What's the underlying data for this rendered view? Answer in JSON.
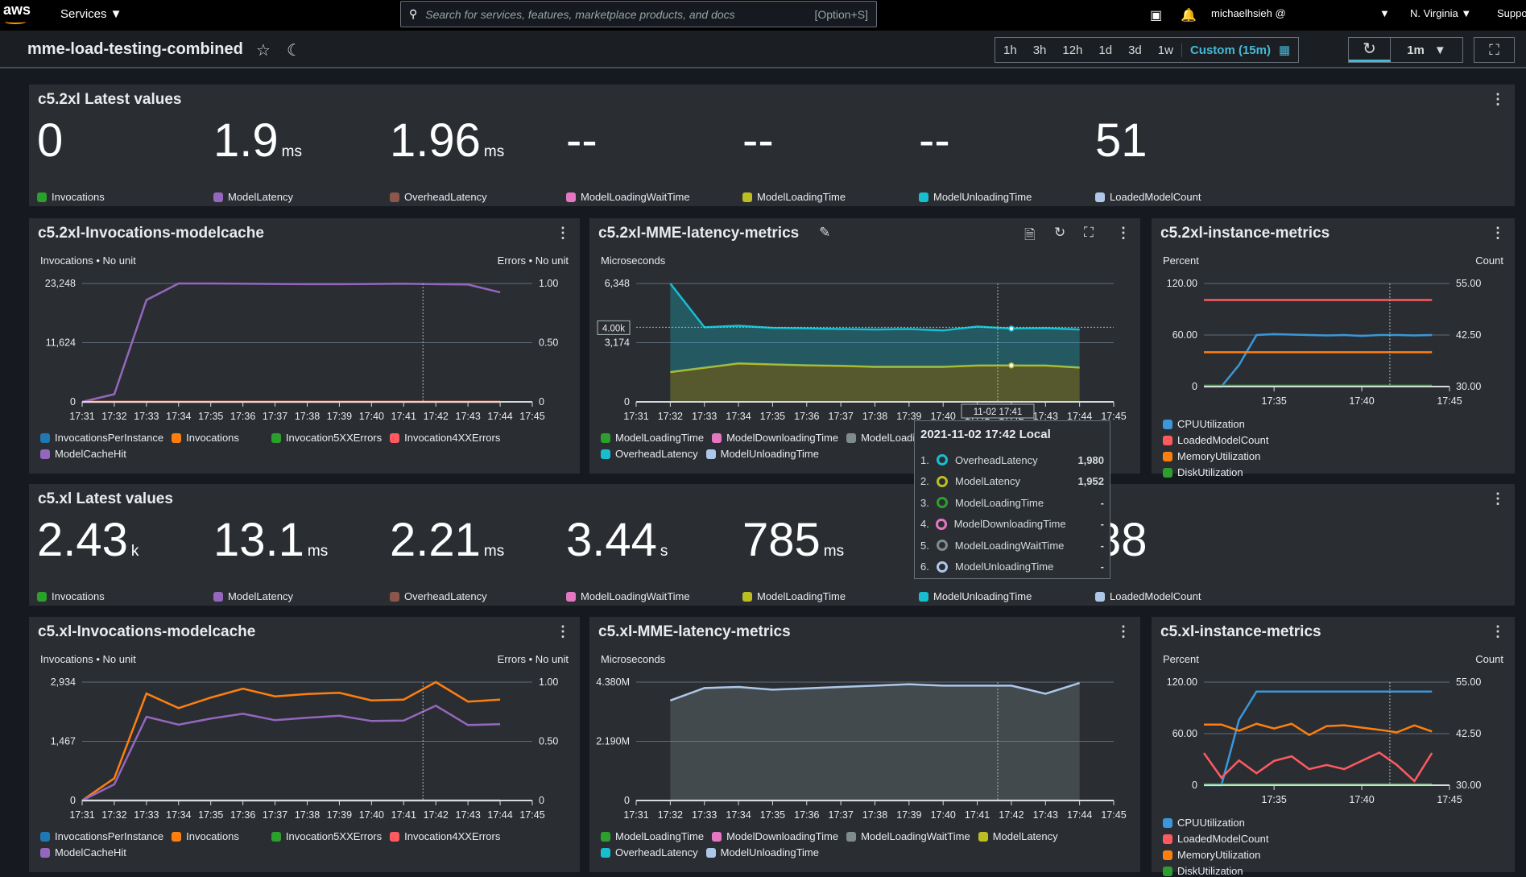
{
  "topbar": {
    "logo": "aws",
    "services_label": "Services ▼",
    "search_placeholder": "Search for services, features, marketplace products, and docs",
    "search_shortcut": "[Option+S]",
    "user": "michaelhsieh @",
    "region": "N. Virginia ▼",
    "support": "Suppo"
  },
  "header": {
    "title": "mme-load-testing-combined",
    "time_ranges": [
      "1h",
      "3h",
      "12h",
      "1d",
      "3d",
      "1w"
    ],
    "custom_range": "Custom (15m)",
    "refresh_interval": "1m"
  },
  "colors": {
    "Invocations": "#2ca02c",
    "ModelLatency": "#9467bd",
    "OverheadLatency": "#8c564b",
    "ModelLoadingWaitTime": "#e377c2",
    "ModelLoadingTime": "#bcbd22",
    "ModelUnloadingTime": "#17becf",
    "LoadedModelCount": "#aec7e8"
  },
  "single_value_widgets": [
    {
      "title": "c5.2xl Latest values",
      "items": [
        {
          "value": "0",
          "unit": "",
          "label": "Invocations",
          "color": "#2ca02c"
        },
        {
          "value": "1.9",
          "unit": "ms",
          "label": "ModelLatency",
          "color": "#9467bd"
        },
        {
          "value": "1.96",
          "unit": "ms",
          "label": "OverheadLatency",
          "color": "#8c564b"
        },
        {
          "value": "--",
          "unit": "",
          "label": "ModelLoadingWaitTime",
          "color": "#e377c2"
        },
        {
          "value": "--",
          "unit": "",
          "label": "ModelLoadingTime",
          "color": "#bcbd22"
        },
        {
          "value": "--",
          "unit": "",
          "label": "ModelUnloadingTime",
          "color": "#17becf"
        },
        {
          "value": "51",
          "unit": "",
          "label": "LoadedModelCount",
          "color": "#aec7e8"
        }
      ]
    },
    {
      "title": "c5.xl Latest values",
      "items": [
        {
          "value": "2.43",
          "unit": "k",
          "label": "Invocations",
          "color": "#2ca02c"
        },
        {
          "value": "13.1",
          "unit": "ms",
          "label": "ModelLatency",
          "color": "#9467bd"
        },
        {
          "value": "2.21",
          "unit": "ms",
          "label": "OverheadLatency",
          "color": "#8c564b"
        },
        {
          "value": "3.44",
          "unit": "s",
          "label": "ModelLoadingWaitTime",
          "color": "#e377c2"
        },
        {
          "value": "785",
          "unit": "ms",
          "label": "ModelLoadingTime",
          "color": "#bcbd22"
        },
        {
          "value": "",
          "unit": "",
          "label": "ModelUnloadingTime",
          "color": "#17becf"
        },
        {
          "value": "38",
          "unit": "",
          "label": "LoadedModelCount",
          "color": "#aec7e8"
        }
      ]
    }
  ],
  "chart_data": [
    {
      "type": "line",
      "kind": "ops",
      "title": "c5.2xl-Invocations-modelcache",
      "left_label": "Invocations • No unit",
      "right_label": "Errors • No unit",
      "x": [
        "17:31",
        "17:32",
        "17:33",
        "17:34",
        "17:35",
        "17:36",
        "17:37",
        "17:38",
        "17:39",
        "17:40",
        "17:41",
        "17:42",
        "17:43",
        "17:44"
      ],
      "xlim": [
        "17:31",
        "17:45"
      ],
      "xticks": [
        "17:31",
        "17:32",
        "17:33",
        "17:34",
        "17:35",
        "17:36",
        "17:37",
        "17:38",
        "17:39",
        "17:40",
        "17:41",
        "17:42",
        "17:43",
        "17:44",
        "17:45"
      ],
      "ylim_left": [
        0,
        23248
      ],
      "yticks_left": [
        "0",
        "11,624",
        "23,248"
      ],
      "ylim_right": [
        0,
        1
      ],
      "yticks_right": [
        "0",
        "0.50",
        "1.00"
      ],
      "series": [
        {
          "name": "InvocationsPerInstance",
          "color": "#1f77b4",
          "axis": "left",
          "values": []
        },
        {
          "name": "Invocations",
          "color": "#ff7f0e",
          "axis": "left",
          "values": [
            0,
            0,
            0,
            0,
            0,
            0,
            0,
            0,
            0,
            0,
            0,
            0,
            0,
            0
          ]
        },
        {
          "name": "Invocation5XXErrors",
          "color": "#2ca02c",
          "axis": "right",
          "values": []
        },
        {
          "name": "Invocation4XXErrors",
          "color": "#ff5a5f",
          "axis": "right",
          "values": [
            0,
            0,
            0,
            0,
            0,
            0,
            0,
            0,
            0,
            0,
            0,
            0,
            0,
            0
          ]
        },
        {
          "name": "ModelCacheHit",
          "color": "#9467bd",
          "axis": "left",
          "values": [
            0,
            1500,
            20000,
            23248,
            23248,
            23200,
            23150,
            23100,
            23100,
            23150,
            23200,
            23100,
            23050,
            21500
          ]
        }
      ]
    },
    {
      "type": "area",
      "kind": "latency",
      "title": "c5.2xl-MME-latency-metrics",
      "left_label": "Microseconds",
      "stacked": true,
      "x": [
        "17:31",
        "17:32",
        "17:33",
        "17:34",
        "17:35",
        "17:36",
        "17:37",
        "17:38",
        "17:39",
        "17:40",
        "17:41",
        "17:42",
        "17:43",
        "17:44"
      ],
      "xlim": [
        "17:31",
        "17:45"
      ],
      "xticks": [
        "17:31",
        "17:32",
        "17:33",
        "17:34",
        "17:35",
        "17:36",
        "17:37",
        "17:38",
        "17:39",
        "17:40",
        "17:41",
        "17:42",
        "17:43",
        "17:44",
        "17:45"
      ],
      "ylim_left": [
        0,
        6348
      ],
      "yticks_left": [
        "0",
        "3,174",
        "6,348"
      ],
      "hover": {
        "y_label": "4.00k",
        "y_value": 4000,
        "x_label": "11-02 17:41"
      },
      "series": [
        {
          "name": "ModelLoadingTime",
          "color": "#2ca02c",
          "axis": "left",
          "values": []
        },
        {
          "name": "ModelDownloadingTime",
          "color": "#e377c2",
          "axis": "left",
          "values": []
        },
        {
          "name": "ModelLoadingWaitTime",
          "color": "#7f8c8d",
          "axis": "left",
          "values": []
        },
        {
          "name": "ModelLatency",
          "color": "#bcbd22",
          "axis": "left",
          "values": [
            null,
            1600,
            1830,
            2060,
            2010,
            1960,
            1930,
            1880,
            1880,
            1880,
            1950,
            1952,
            1950,
            1840
          ]
        },
        {
          "name": "OverheadLatency",
          "color": "#17becf",
          "axis": "left",
          "values": [
            null,
            4748,
            2170,
            2020,
            1960,
            1980,
            1980,
            2000,
            2030,
            1950,
            2090,
            1980,
            2000,
            2040
          ]
        },
        {
          "name": "ModelUnloadingTime",
          "color": "#aec7e8",
          "axis": "left",
          "values": []
        }
      ]
    },
    {
      "type": "line",
      "kind": "instance",
      "title": "c5.2xl-instance-metrics",
      "left_label": "Percent",
      "right_label": "Count",
      "x": [
        "17:31",
        "17:32",
        "17:33",
        "17:34",
        "17:35",
        "17:36",
        "17:37",
        "17:38",
        "17:39",
        "17:40",
        "17:41",
        "17:42",
        "17:43",
        "17:44"
      ],
      "xlim": [
        "17:31",
        "17:45"
      ],
      "xticks": [
        "17:35",
        "17:40",
        "17:45"
      ],
      "ylim_left": [
        0,
        120
      ],
      "yticks_left": [
        "0",
        "60.00",
        "120.00"
      ],
      "ylim_right": [
        30,
        55
      ],
      "yticks_right": [
        "30.00",
        "42.50",
        "55.00"
      ],
      "series": [
        {
          "name": "CPUUtilization",
          "color": "#3b97d9",
          "axis": "left",
          "values": [
            0,
            0,
            25,
            60,
            61,
            60.5,
            60,
            59.5,
            60,
            59,
            60,
            60,
            59.5,
            60
          ]
        },
        {
          "name": "LoadedModelCount",
          "color": "#ff5a5f",
          "axis": "right",
          "values": [
            51,
            51,
            51,
            51,
            51,
            51,
            51,
            51,
            51,
            51,
            51,
            51,
            51,
            51
          ]
        },
        {
          "name": "MemoryUtilization",
          "color": "#ff7f0e",
          "axis": "left",
          "values": [
            40,
            40,
            40,
            40,
            40,
            40,
            40,
            40,
            40,
            40,
            40,
            40,
            40,
            40
          ]
        },
        {
          "name": "DiskUtilization",
          "color": "#2ca02c",
          "axis": "left",
          "values": [
            1,
            1,
            1,
            1,
            1,
            1,
            1,
            1,
            1,
            1,
            1,
            1,
            1,
            1
          ]
        }
      ]
    },
    {
      "type": "line",
      "kind": "ops",
      "title": "c5.xl-Invocations-modelcache",
      "left_label": "Invocations • No unit",
      "right_label": "Errors • No unit",
      "x": [
        "17:31",
        "17:32",
        "17:33",
        "17:34",
        "17:35",
        "17:36",
        "17:37",
        "17:38",
        "17:39",
        "17:40",
        "17:41",
        "17:42",
        "17:43",
        "17:44"
      ],
      "xlim": [
        "17:31",
        "17:45"
      ],
      "xticks": [
        "17:31",
        "17:32",
        "17:33",
        "17:34",
        "17:35",
        "17:36",
        "17:37",
        "17:38",
        "17:39",
        "17:40",
        "17:41",
        "17:42",
        "17:43",
        "17:44",
        "17:45"
      ],
      "ylim_left": [
        0,
        2934
      ],
      "yticks_left": [
        "0",
        "1,467",
        "2,934"
      ],
      "ylim_right": [
        0,
        1
      ],
      "yticks_right": [
        "0",
        "0.50",
        "1.00"
      ],
      "series": [
        {
          "name": "InvocationsPerInstance",
          "color": "#1f77b4",
          "axis": "left",
          "values": []
        },
        {
          "name": "Invocations",
          "color": "#ff7f0e",
          "axis": "left",
          "values": [
            0,
            550,
            2650,
            2290,
            2550,
            2770,
            2580,
            2640,
            2670,
            2480,
            2500,
            2934,
            2450,
            2500
          ]
        },
        {
          "name": "Invocation5XXErrors",
          "color": "#2ca02c",
          "axis": "right",
          "values": [
            0,
            0,
            0,
            0,
            0,
            0,
            0,
            0,
            0,
            0,
            0,
            0,
            0,
            0
          ]
        },
        {
          "name": "Invocation4XXErrors",
          "color": "#ff5a5f",
          "axis": "right",
          "values": [
            0,
            0,
            0,
            0,
            0,
            0,
            0,
            0,
            0,
            0,
            0,
            0,
            0,
            0
          ]
        },
        {
          "name": "ModelCacheHit",
          "color": "#9467bd",
          "axis": "left",
          "values": [
            0,
            400,
            2075,
            1880,
            2030,
            2150,
            1990,
            2050,
            2100,
            1970,
            1980,
            2350,
            1870,
            1890
          ]
        }
      ]
    },
    {
      "type": "area",
      "kind": "latency",
      "title": "c5.xl-MME-latency-metrics",
      "left_label": "Microseconds",
      "stacked": false,
      "x": [
        "17:31",
        "17:32",
        "17:33",
        "17:34",
        "17:35",
        "17:36",
        "17:37",
        "17:38",
        "17:39",
        "17:40",
        "17:41",
        "17:42",
        "17:43",
        "17:44"
      ],
      "xlim": [
        "17:31",
        "17:45"
      ],
      "xticks": [
        "17:31",
        "17:32",
        "17:33",
        "17:34",
        "17:35",
        "17:36",
        "17:37",
        "17:38",
        "17:39",
        "17:40",
        "17:41",
        "17:42",
        "17:43",
        "17:44",
        "17:45"
      ],
      "ylim_left": [
        0,
        4380000
      ],
      "yticks_left": [
        "0",
        "2.190M",
        "4.380M"
      ],
      "series": [
        {
          "name": "ModelLoadingTime",
          "color": "#2ca02c",
          "axis": "left",
          "values": [
            null,
            820,
            790,
            790,
            790,
            790,
            790,
            790,
            790,
            790,
            790,
            790,
            790,
            790
          ],
          "scale": 1000
        },
        {
          "name": "ModelDownloadingTime",
          "color": "#e377c2",
          "axis": "left",
          "values": []
        },
        {
          "name": "ModelLoadingWaitTime",
          "color": "#7f8c8d",
          "axis": "left",
          "stroke": "#aec7e8",
          "values": [
            null,
            3700000,
            4160000,
            4200000,
            4100000,
            4150000,
            4200000,
            4250000,
            4300000,
            4250000,
            4250000,
            4250000,
            3950000,
            4350000
          ]
        },
        {
          "name": "ModelLatency",
          "color": "#bcbd22",
          "axis": "left",
          "values": []
        },
        {
          "name": "OverheadLatency",
          "color": "#17becf",
          "axis": "left",
          "values": []
        },
        {
          "name": "ModelUnloadingTime",
          "color": "#aec7e8",
          "axis": "left",
          "values": []
        }
      ]
    },
    {
      "type": "line",
      "kind": "instance",
      "title": "c5.xl-instance-metrics",
      "left_label": "Percent",
      "right_label": "Count",
      "x": [
        "17:31",
        "17:32",
        "17:33",
        "17:34",
        "17:35",
        "17:36",
        "17:37",
        "17:38",
        "17:39",
        "17:40",
        "17:41",
        "17:42",
        "17:43",
        "17:44"
      ],
      "xlim": [
        "17:31",
        "17:45"
      ],
      "xticks": [
        "17:35",
        "17:40",
        "17:45"
      ],
      "ylim_left": [
        0,
        120
      ],
      "yticks_left": [
        "0",
        "60.00",
        "120.00"
      ],
      "ylim_right": [
        30,
        55
      ],
      "yticks_right": [
        "30.00",
        "42.50",
        "55.00"
      ],
      "series": [
        {
          "name": "CPUUtilization",
          "color": "#3b97d9",
          "axis": "left",
          "values": [
            0,
            0,
            76,
            109,
            109,
            109,
            109,
            109,
            109,
            109,
            109,
            109,
            109,
            109
          ]
        },
        {
          "name": "LoadedModelCount",
          "color": "#ff5a5f",
          "axis": "right",
          "values": [
            37.8,
            31.8,
            36,
            32.9,
            35.9,
            37,
            33.9,
            34.9,
            33.9,
            35.9,
            37.9,
            34.9,
            31,
            37.8
          ]
        },
        {
          "name": "MemoryUtilization",
          "color": "#ff7f0e",
          "axis": "left",
          "values": [
            70.6,
            70.6,
            63.4,
            71.5,
            66,
            71.5,
            58.4,
            68.8,
            69.7,
            67,
            64.5,
            61.5,
            69.7,
            62.5
          ]
        },
        {
          "name": "DiskUtilization",
          "color": "#2ca02c",
          "axis": "left",
          "values": [
            1,
            1,
            1,
            1,
            1,
            1,
            1,
            1,
            1,
            1,
            1,
            1,
            1,
            1
          ]
        }
      ]
    }
  ],
  "tooltip": {
    "title": "2021-11-02 17:42 Local",
    "rows": [
      {
        "idx": "1.",
        "name": "OverheadLatency",
        "value": "1,980",
        "color": "#17becf"
      },
      {
        "idx": "2.",
        "name": "ModelLatency",
        "value": "1,952",
        "color": "#bcbd22"
      },
      {
        "idx": "3.",
        "name": "ModelLoadingTime",
        "value": "-",
        "color": "#2ca02c"
      },
      {
        "idx": "4.",
        "name": "ModelDownloadingTime",
        "value": "-",
        "color": "#e377c2"
      },
      {
        "idx": "5.",
        "name": "ModelLoadingWaitTime",
        "value": "-",
        "color": "#7f8c8d"
      },
      {
        "idx": "6.",
        "name": "ModelUnloadingTime",
        "value": "-",
        "color": "#aec7e8"
      }
    ]
  }
}
